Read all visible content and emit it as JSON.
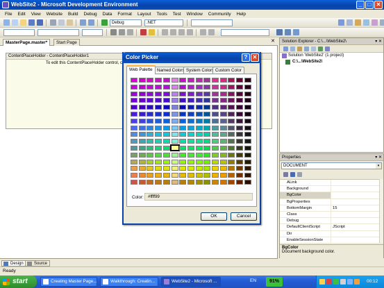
{
  "window": {
    "title": "WebSite2 - Microsoft Development Environment",
    "min": "_",
    "max": "□",
    "close": "✕"
  },
  "menu": [
    "File",
    "Edit",
    "View",
    "Website",
    "Build",
    "Debug",
    "Data",
    "Format",
    "Layout",
    "Tools",
    "Test",
    "Window",
    "Community",
    "Help"
  ],
  "toolbar": {
    "config_combo": "Debug",
    "platform_combo": ".NET"
  },
  "doc_tabs": [
    "MasterPage.master*",
    "Start Page"
  ],
  "doc_close": "✕",
  "editor": {
    "cph_header": "ContentPlaceHolder - ContentPlaceHolder1",
    "cph_text": "To edit this ContentPlaceHolder control, clic"
  },
  "view_tabs": [
    "Design",
    "Source"
  ],
  "solution_explorer": {
    "title": "Solution Explorer - C:\\...\\WebSite2\\",
    "tree": [
      "Solution 'WebSite2' (1 project)",
      "C:\\...\\WebSite2\\"
    ]
  },
  "properties": {
    "title": "Properties",
    "object": "DOCUMENT",
    "rows": [
      {
        "name": "ALink",
        "value": ""
      },
      {
        "name": "Background",
        "value": ""
      },
      {
        "name": "BgColor",
        "value": ""
      },
      {
        "name": "BgProperties",
        "value": ""
      },
      {
        "name": "BottomMargin",
        "value": "15"
      },
      {
        "name": "Class",
        "value": ""
      },
      {
        "name": "Debug",
        "value": ""
      },
      {
        "name": "DefaultClientScript",
        "value": "JScript"
      },
      {
        "name": "Dir",
        "value": ""
      },
      {
        "name": "EnableSessionState",
        "value": ""
      }
    ],
    "selected": "BgColor",
    "desc_title": "BgColor",
    "desc_text": "Document background color."
  },
  "status": "Ready",
  "dialog": {
    "title": "Color Picker",
    "help": "?",
    "close": "✕",
    "tabs": [
      "Web Palette",
      "Named Colors",
      "System Colors",
      "Custom Color"
    ],
    "color_label": "Color:",
    "color_value": "#ffff99",
    "ok": "OK",
    "cancel": "Cancel",
    "palette_columns": [
      "#ff00ff",
      "#ff33cc",
      "#ff66cc",
      "#ff99cc",
      "#ffcccc",
      "#ffffff",
      "#ccff99",
      "#99ff66",
      "#66ff33",
      "#33ff00",
      "#ff9900",
      "#ff6600",
      "#ff3300",
      "#cc0000",
      "#990000"
    ],
    "selected_color": "#ffff99"
  },
  "taskbar": {
    "start": "start",
    "items": [
      "Creating Master Page...",
      "Walkthrough: Creatin...",
      "WebSite2 - Microsoft ..."
    ],
    "lang": "EN",
    "battery": "91%",
    "clock": "00:12"
  },
  "colors": {
    "xp_blue": "#0842a8",
    "start_green": "#2e8b2e",
    "tray": "#0f86d8"
  }
}
